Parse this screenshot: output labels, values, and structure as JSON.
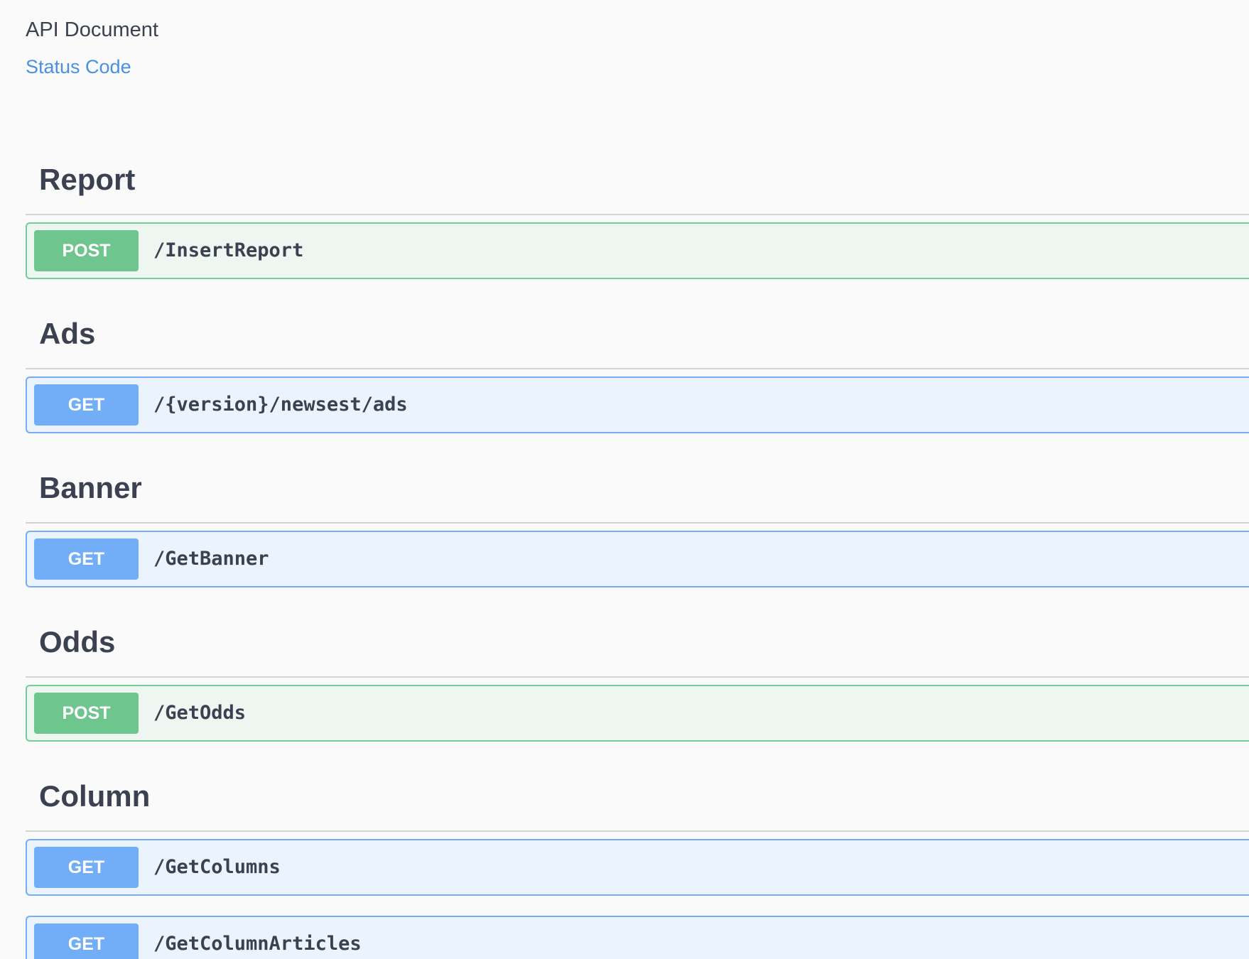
{
  "header": {
    "title": "API Document",
    "status_link": "Status Code"
  },
  "sections": [
    {
      "name": "Report",
      "operations": [
        {
          "method": "POST",
          "path": "/InsertReport"
        }
      ]
    },
    {
      "name": "Ads",
      "operations": [
        {
          "method": "GET",
          "path": "/{version}/newsest/ads"
        }
      ]
    },
    {
      "name": "Banner",
      "operations": [
        {
          "method": "GET",
          "path": "/GetBanner"
        }
      ]
    },
    {
      "name": "Odds",
      "operations": [
        {
          "method": "POST",
          "path": "/GetOdds"
        }
      ]
    },
    {
      "name": "Column",
      "operations": [
        {
          "method": "GET",
          "path": "/GetColumns"
        },
        {
          "method": "GET",
          "path": "/GetColumnArticles"
        }
      ]
    }
  ],
  "colors": {
    "post_accent": "#6fc58e",
    "get_accent": "#72adf7",
    "link": "#4990e2",
    "text": "#3b4151"
  }
}
